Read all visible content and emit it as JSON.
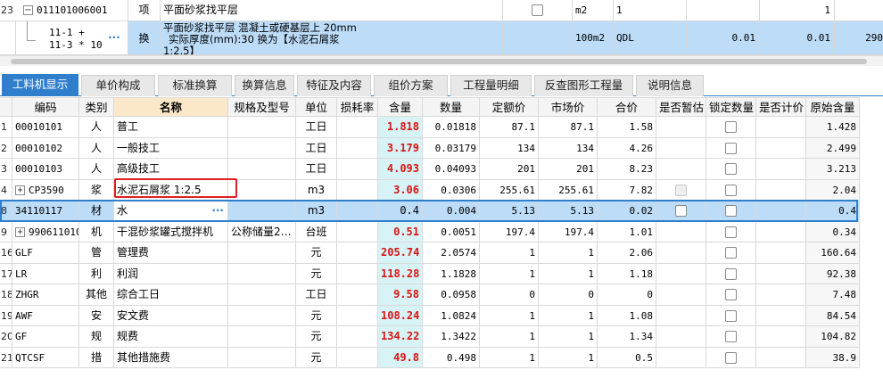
{
  "top_rows": [
    {
      "row_no": "23",
      "toggle": "−",
      "code": "011101006001",
      "type": "项",
      "name": "平面砂浆找平层",
      "unit": "m2",
      "col_a": "1",
      "col_b": "",
      "col_c": "1",
      "col_d": ""
    },
    {
      "row_no": "",
      "code_l1": "11-1 +",
      "code_l2": "11-3 * 10",
      "more": "···",
      "type": "换",
      "name_l1": "平面砂浆找平层 混凝土或硬基层上 20mm",
      "name_l2": "实际厚度(mm):30 换为【水泥石屑浆",
      "name_l3": "1:2.5】",
      "unit": "100m2",
      "col_a": "QDL",
      "col_b": "0.01",
      "col_c": "0.01",
      "col_d": "290"
    }
  ],
  "tabs": [
    "工料机显示",
    "单价构成",
    "标准换算",
    "换算信息",
    "特征及内容",
    "组价方案",
    "工程量明细",
    "反查图形工程量",
    "说明信息"
  ],
  "active_tab": 0,
  "headers": [
    "编码",
    "类别",
    "名称",
    "规格及型号",
    "单位",
    "损耗率",
    "含量",
    "数量",
    "定额价",
    "市场价",
    "合价",
    "是否暂估",
    "锁定数量",
    "是否计价",
    "原始含量"
  ],
  "rows": [
    {
      "no": "1",
      "code": "00010101",
      "cat": "人",
      "name": "普工",
      "spec": "",
      "unit": "工日",
      "loss": "",
      "qty": "1.818",
      "amount": "0.01818",
      "quota": "87.1",
      "market": "87.1",
      "total": "1.58",
      "est": "",
      "lock": "box",
      "price": "",
      "orig": "1.428"
    },
    {
      "no": "2",
      "code": "00010102",
      "cat": "人",
      "name": "一般技工",
      "spec": "",
      "unit": "工日",
      "loss": "",
      "qty": "3.179",
      "amount": "0.03179",
      "quota": "134",
      "market": "134",
      "total": "4.26",
      "est": "",
      "lock": "box",
      "price": "",
      "orig": "2.499"
    },
    {
      "no": "3",
      "code": "00010103",
      "cat": "人",
      "name": "高级技工",
      "spec": "",
      "unit": "工日",
      "loss": "",
      "qty": "4.093",
      "amount": "0.04093",
      "quota": "201",
      "market": "201",
      "total": "8.23",
      "est": "",
      "lock": "box",
      "price": "",
      "orig": "3.213"
    },
    {
      "no": "4",
      "code": "CP3590",
      "cat": "浆",
      "name": "水泥石屑浆 1:2.5",
      "spec": "",
      "unit": "m3",
      "loss": "",
      "qty": "3.06",
      "amount": "0.0306",
      "quota": "255.61",
      "market": "255.61",
      "total": "7.82",
      "est": "dis",
      "lock": "box",
      "price": "",
      "orig": "2.04",
      "expand": true
    },
    {
      "no": "8",
      "code": "34110117",
      "cat": "材",
      "name": "水",
      "spec": "",
      "unit": "m3",
      "loss": "",
      "qty": "0.4",
      "amount": "0.004",
      "quota": "5.13",
      "market": "5.13",
      "total": "0.02",
      "est": "box",
      "lock": "box",
      "price": "",
      "orig": "0.4",
      "selected": true
    },
    {
      "no": "9",
      "code": "990611010",
      "cat": "机",
      "name": "干混砂浆罐式搅拌机",
      "spec": "公称储量2…",
      "unit": "台班",
      "loss": "",
      "qty": "0.51",
      "amount": "0.0051",
      "quota": "197.4",
      "market": "197.4",
      "total": "1.01",
      "est": "",
      "lock": "box",
      "price": "",
      "orig": "0.34",
      "expand": true
    },
    {
      "no": "16",
      "code": "GLF",
      "cat": "管",
      "name": "管理费",
      "spec": "",
      "unit": "元",
      "loss": "",
      "qty": "205.74",
      "amount": "2.0574",
      "quota": "1",
      "market": "1",
      "total": "2.06",
      "est": "",
      "lock": "box",
      "price": "",
      "orig": "160.64"
    },
    {
      "no": "17",
      "code": "LR",
      "cat": "利",
      "name": "利润",
      "spec": "",
      "unit": "元",
      "loss": "",
      "qty": "118.28",
      "amount": "1.1828",
      "quota": "1",
      "market": "1",
      "total": "1.18",
      "est": "",
      "lock": "box",
      "price": "",
      "orig": "92.38"
    },
    {
      "no": "18",
      "code": "ZHGR",
      "cat": "其他",
      "name": "综合工日",
      "spec": "",
      "unit": "工日",
      "loss": "",
      "qty": "9.58",
      "amount": "0.0958",
      "quota": "0",
      "market": "0",
      "total": "0",
      "est": "",
      "lock": "box",
      "price": "",
      "orig": "7.48"
    },
    {
      "no": "19",
      "code": "AWF",
      "cat": "安",
      "name": "安文费",
      "spec": "",
      "unit": "元",
      "loss": "",
      "qty": "108.24",
      "amount": "1.0824",
      "quota": "1",
      "market": "1",
      "total": "1.08",
      "est": "",
      "lock": "box",
      "price": "",
      "orig": "84.54"
    },
    {
      "no": "20",
      "code": "GF",
      "cat": "规",
      "name": "规费",
      "spec": "",
      "unit": "元",
      "loss": "",
      "qty": "134.22",
      "amount": "1.3422",
      "quota": "1",
      "market": "1",
      "total": "1.34",
      "est": "",
      "lock": "box",
      "price": "",
      "orig": "104.82"
    },
    {
      "no": "21",
      "code": "QTCSF",
      "cat": "措",
      "name": "其他措施费",
      "spec": "",
      "unit": "元",
      "loss": "",
      "qty": "49.8",
      "amount": "0.498",
      "quota": "1",
      "market": "1",
      "total": "0.5",
      "est": "",
      "lock": "box",
      "price": "",
      "orig": "38.9"
    }
  ],
  "colors": {
    "accent": "#2f7fcc",
    "selected_row": "#bcdcf8",
    "qty_bg": "#d8f3f6",
    "qty_text": "#d81414",
    "highlight_box": "#e02020"
  }
}
